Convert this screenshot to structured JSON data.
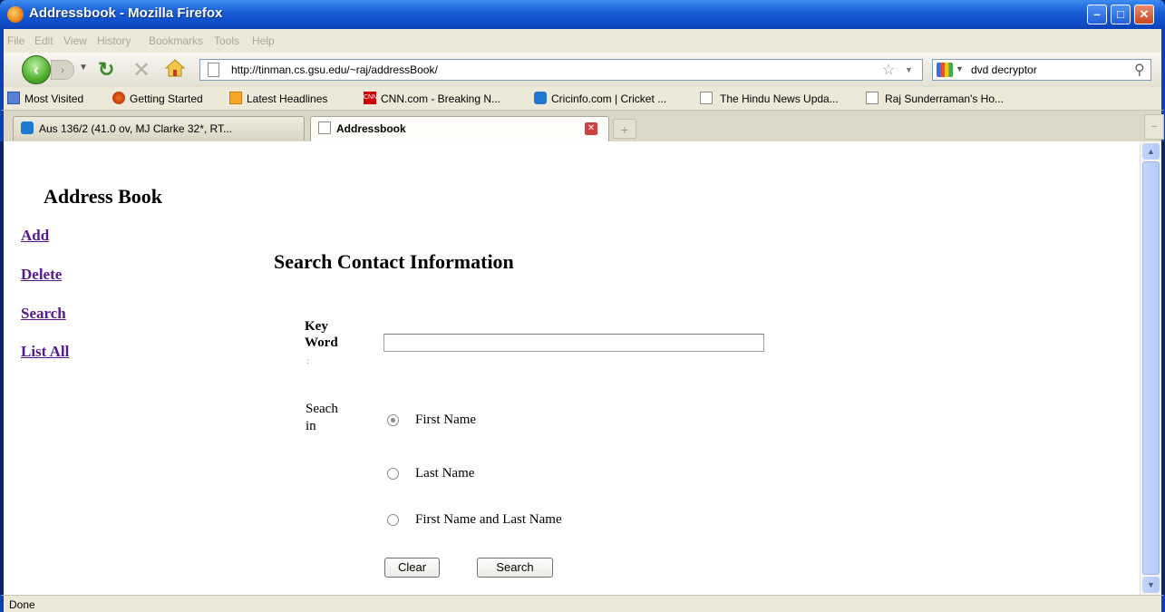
{
  "window": {
    "title": "Addressbook - Mozilla Firefox"
  },
  "menu": [
    "File",
    "Edit",
    "View",
    "History",
    "Bookmarks",
    "Tools",
    "Help"
  ],
  "nav": {
    "url": "http://tinman.cs.gsu.edu/~raj/addressBook/",
    "search_value": "dvd decryptor"
  },
  "bookmarks": [
    "Most Visited",
    "Getting Started",
    "Latest Headlines",
    "CNN.com - Breaking N...",
    "Cricinfo.com | Cricket ...",
    "The Hindu News Upda...",
    "Raj Sunderraman's Ho..."
  ],
  "tabs": [
    {
      "label": "Aus 136/2 (41.0 ov, MJ Clarke 32*, RT...",
      "active": false
    },
    {
      "label": "Addressbook",
      "active": true
    }
  ],
  "page": {
    "app_title": "Address Book",
    "links": [
      "Add",
      "Delete",
      "Search",
      "List All"
    ],
    "section_title": "Search Contact Information",
    "keyword_label_1": "Key",
    "keyword_label_2": "Word",
    "keyword_colon": ":",
    "keyword_value": "",
    "search_in_label_1": "Seach",
    "search_in_label_2": "in",
    "options": [
      {
        "label": "First Name",
        "checked": true
      },
      {
        "label": "Last Name",
        "checked": false
      },
      {
        "label": "First Name and Last Name",
        "checked": false
      }
    ],
    "clear_label": "Clear",
    "search_label": "Search"
  },
  "status": "Done",
  "colors": {
    "titlebar": "#0c41b6",
    "link": "#551a8b",
    "chrome": "#ece9d8"
  },
  "icons": [
    "firefox-icon",
    "back-icon",
    "forward-icon",
    "reload-icon",
    "stop-icon",
    "home-icon",
    "page-icon",
    "star-icon",
    "google-icon",
    "magnifier-icon",
    "minimize-icon",
    "maximize-icon",
    "close-icon"
  ]
}
